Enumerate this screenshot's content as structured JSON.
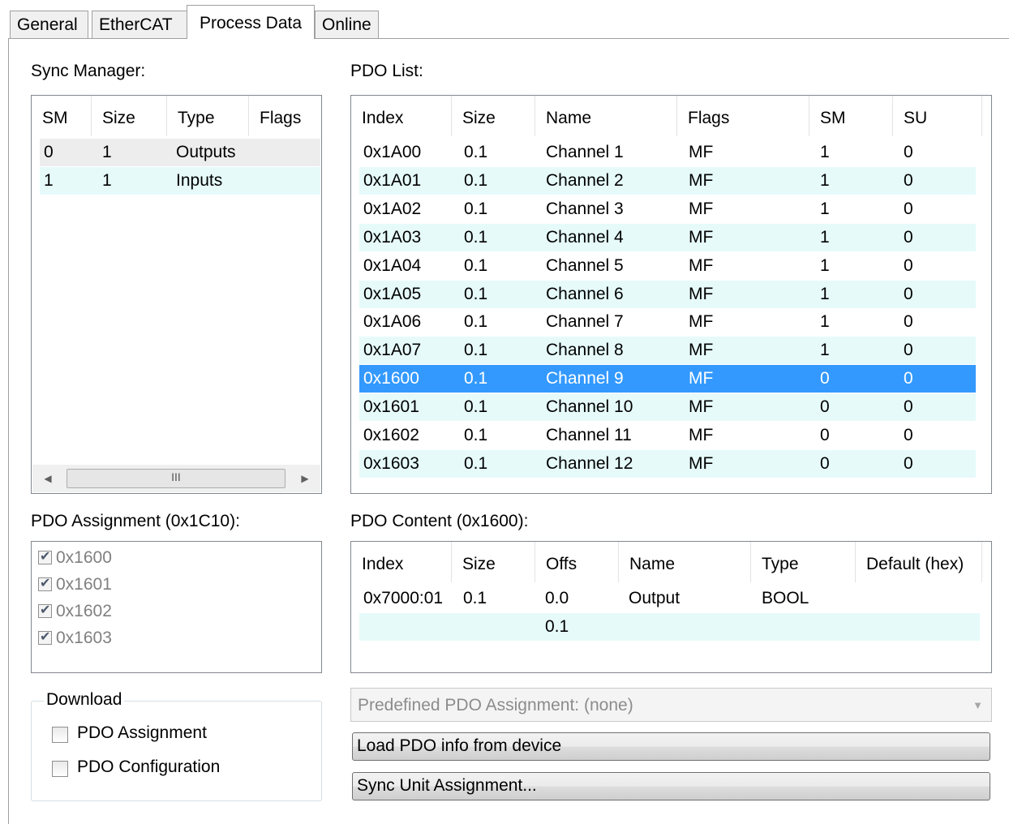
{
  "tabs": [
    {
      "label": "General"
    },
    {
      "label": "EtherCAT"
    },
    {
      "label": "Process Data"
    },
    {
      "label": "Online"
    }
  ],
  "sync_manager": {
    "title": "Sync Manager:",
    "columns": [
      "SM",
      "Size",
      "Type",
      "Flags"
    ],
    "rows": [
      [
        "0",
        "1",
        "Outputs",
        ""
      ],
      [
        "1",
        "1",
        "Inputs",
        ""
      ]
    ],
    "scroll_thumb_glyph": "III"
  },
  "pdo_list": {
    "title": "PDO List:",
    "columns": [
      "Index",
      "Size",
      "Name",
      "Flags",
      "SM",
      "SU"
    ],
    "rows": [
      [
        "0x1A00",
        "0.1",
        "Channel 1",
        "MF",
        "1",
        "0"
      ],
      [
        "0x1A01",
        "0.1",
        "Channel 2",
        "MF",
        "1",
        "0"
      ],
      [
        "0x1A02",
        "0.1",
        "Channel 3",
        "MF",
        "1",
        "0"
      ],
      [
        "0x1A03",
        "0.1",
        "Channel 4",
        "MF",
        "1",
        "0"
      ],
      [
        "0x1A04",
        "0.1",
        "Channel 5",
        "MF",
        "1",
        "0"
      ],
      [
        "0x1A05",
        "0.1",
        "Channel 6",
        "MF",
        "1",
        "0"
      ],
      [
        "0x1A06",
        "0.1",
        "Channel 7",
        "MF",
        "1",
        "0"
      ],
      [
        "0x1A07",
        "0.1",
        "Channel 8",
        "MF",
        "1",
        "0"
      ],
      [
        "0x1600",
        "0.1",
        "Channel 9",
        "MF",
        "0",
        "0"
      ],
      [
        "0x1601",
        "0.1",
        "Channel 10",
        "MF",
        "0",
        "0"
      ],
      [
        "0x1602",
        "0.1",
        "Channel 11",
        "MF",
        "0",
        "0"
      ],
      [
        "0x1603",
        "0.1",
        "Channel 12",
        "MF",
        "0",
        "0"
      ]
    ],
    "selected_row_index": 8
  },
  "pdo_assignment": {
    "title": "PDO Assignment (0x1C10):",
    "items": [
      {
        "label": "0x1600",
        "checked": true
      },
      {
        "label": "0x1601",
        "checked": true
      },
      {
        "label": "0x1602",
        "checked": true
      },
      {
        "label": "0x1603",
        "checked": true
      }
    ]
  },
  "pdo_content": {
    "title": "PDO Content (0x1600):",
    "columns": [
      "Index",
      "Size",
      "Offs",
      "Name",
      "Type",
      "Default (hex)"
    ],
    "rows": [
      [
        "0x7000:01",
        "0.1",
        "0.0",
        "Output",
        "BOOL",
        ""
      ],
      [
        "",
        "",
        "0.1",
        "",
        "",
        ""
      ]
    ]
  },
  "download": {
    "title": "Download",
    "pdo_assignment_label": "PDO Assignment",
    "pdo_configuration_label": "PDO Configuration"
  },
  "predefined": {
    "value": "Predefined PDO Assignment: (none)"
  },
  "buttons": {
    "load_pdo_info": "Load PDO info from device",
    "sync_unit_assignment": "Sync Unit Assignment..."
  }
}
